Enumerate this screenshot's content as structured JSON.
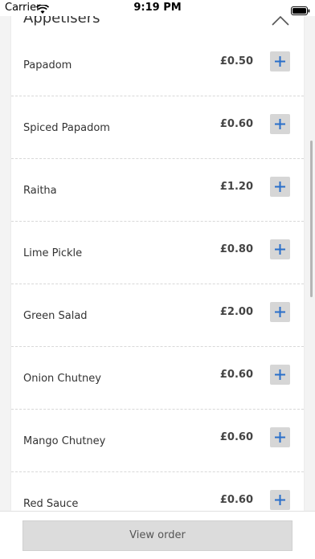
{
  "status_bar": {
    "carrier": "Carrier",
    "time": "9:19 PM"
  },
  "section": {
    "title": "Appetisers"
  },
  "menu_items": [
    {
      "name": "Papadom",
      "price": "£0.50"
    },
    {
      "name": "Spiced Papadom",
      "price": "£0.60"
    },
    {
      "name": "Raitha",
      "price": "£1.20"
    },
    {
      "name": "Lime Pickle",
      "price": "£0.80"
    },
    {
      "name": "Green Salad",
      "price": "£2.00"
    },
    {
      "name": "Onion Chutney",
      "price": "£0.60"
    },
    {
      "name": "Mango Chutney",
      "price": "£0.60"
    },
    {
      "name": "Red Sauce",
      "price": "£0.60"
    }
  ],
  "footer": {
    "view_order_label": "View order"
  },
  "colors": {
    "accent": "#2a6fc9",
    "button_bg": "#d6d6d6",
    "background": "#f3f3f3"
  },
  "icons": {
    "add": "plus-icon",
    "collapse": "chevron-up-icon",
    "wifi": "wifi-icon",
    "battery": "battery-icon"
  }
}
